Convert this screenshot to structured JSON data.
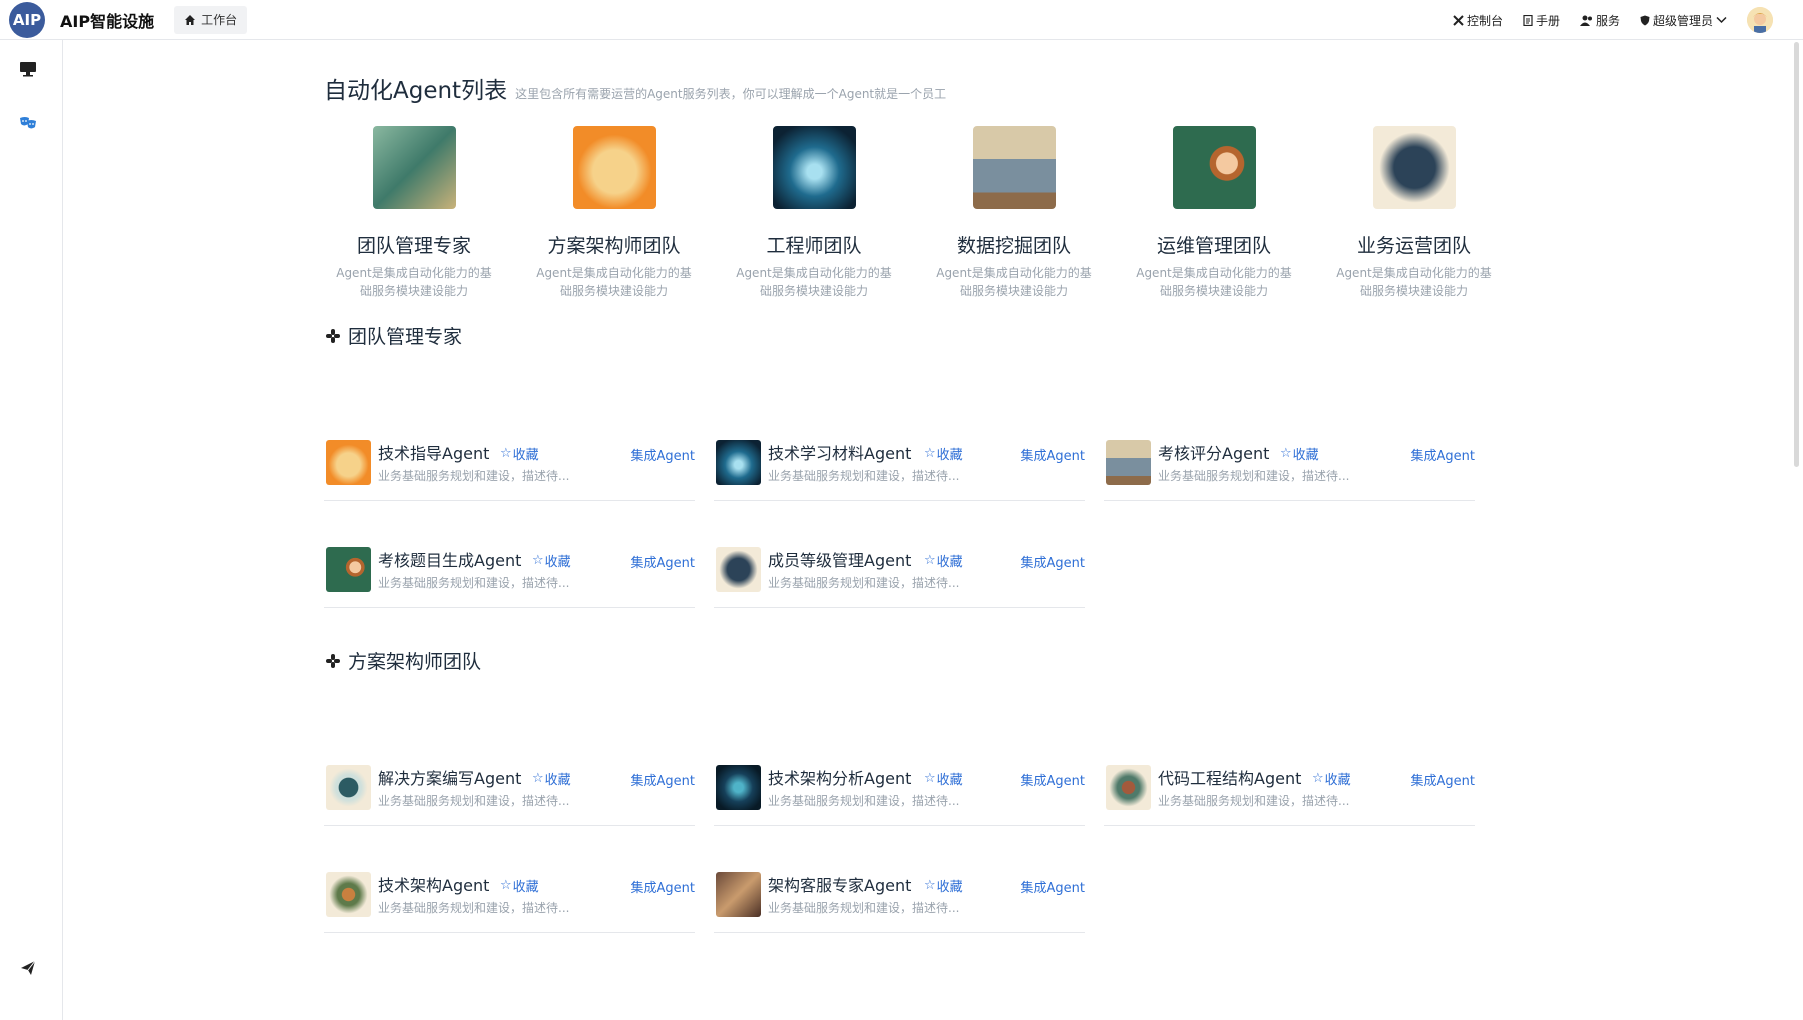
{
  "header": {
    "logo_text": "AIP",
    "brand": "AIP智能设施",
    "home_tab": "工作台",
    "links": [
      {
        "label": "控制台",
        "icon": "tools-icon"
      },
      {
        "label": "手册",
        "icon": "document-icon"
      },
      {
        "label": "服务",
        "icon": "users-icon"
      },
      {
        "label": "超级管理员",
        "icon": "shield-icon"
      }
    ]
  },
  "sidebar": {
    "items": [
      {
        "icon": "monitor-icon"
      },
      {
        "icon": "masks-icon"
      },
      {
        "icon": "send-icon"
      }
    ]
  },
  "page": {
    "title": "自动化Agent列表",
    "subtitle": "这里包含所有需要运营的Agent服务列表，你可以理解成一个Agent就是一个员工"
  },
  "teams": [
    {
      "name": "团队管理专家",
      "desc": "Agent是集成自动化能力的基础服务模块建设能力",
      "color": "#4f8a7b"
    },
    {
      "name": "方案架构师团队",
      "desc": "Agent是集成自动化能力的基础服务模块建设能力",
      "color": "#f28c28"
    },
    {
      "name": "工程师团队",
      "desc": "Agent是集成自动化能力的基础服务模块建设能力",
      "color": "#1f4b6e"
    },
    {
      "name": "数据挖掘团队",
      "desc": "Agent是集成自动化能力的基础服务模块建设能力",
      "color": "#8d7b63"
    },
    {
      "name": "运维管理团队",
      "desc": "Agent是集成自动化能力的基础服务模块建设能力",
      "color": "#2e6b4f"
    },
    {
      "name": "业务运营团队",
      "desc": "Agent是集成自动化能力的基础服务模块建设能力",
      "color": "#2c4358"
    }
  ],
  "sections": [
    {
      "title": "团队管理专家",
      "agents": [
        {
          "name": "技术指导Agent",
          "fav": "收藏",
          "action": "集成Agent",
          "desc": "业务基础服务规划和建设，描述待...",
          "color": "#f28c28"
        },
        {
          "name": "技术学习材料Agent",
          "fav": "收藏",
          "action": "集成Agent",
          "desc": "业务基础服务规划和建设，描述待...",
          "color": "#1f4b6e"
        },
        {
          "name": "考核评分Agent",
          "fav": "收藏",
          "action": "集成Agent",
          "desc": "业务基础服务规划和建设，描述待...",
          "color": "#8d7b63"
        },
        {
          "name": "考核题目生成Agent",
          "fav": "收藏",
          "action": "集成Agent",
          "desc": "业务基础服务规划和建设，描述待...",
          "color": "#2e6b4f"
        },
        {
          "name": "成员等级管理Agent",
          "fav": "收藏",
          "action": "集成Agent",
          "desc": "业务基础服务规划和建设，描述待...",
          "color": "#2c4358"
        }
      ]
    },
    {
      "title": "方案架构师团队",
      "agents": [
        {
          "name": "解决方案编写Agent",
          "fav": "收藏",
          "action": "集成Agent",
          "desc": "业务基础服务规划和建设，描述待...",
          "color": "#2c5b63"
        },
        {
          "name": "技术架构分析Agent",
          "fav": "收藏",
          "action": "集成Agent",
          "desc": "业务基础服务规划和建设，描述待...",
          "color": "#16405a"
        },
        {
          "name": "代码工程结构Agent",
          "fav": "收藏",
          "action": "集成Agent",
          "desc": "业务基础服务规划和建设，描述待...",
          "color": "#a35a3c"
        },
        {
          "name": "技术架构Agent",
          "fav": "收藏",
          "action": "集成Agent",
          "desc": "业务基础服务规划和建设，描述待...",
          "color": "#9c6a3f"
        },
        {
          "name": "架构客服专家Agent",
          "fav": "收藏",
          "action": "集成Agent",
          "desc": "业务基础服务规划和建设，描述待...",
          "color": "#6b4a3a"
        }
      ]
    }
  ]
}
